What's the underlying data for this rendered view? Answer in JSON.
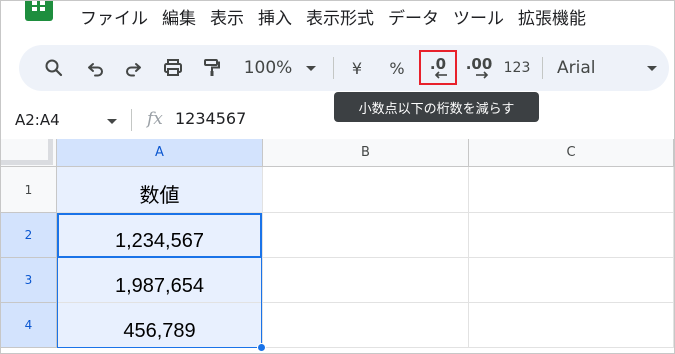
{
  "menu": [
    "ファイル",
    "編集",
    "表示",
    "挿入",
    "表示形式",
    "データ",
    "ツール",
    "拡張機能"
  ],
  "toolbar": {
    "zoom": "100%",
    "currency_label": "¥",
    "percent_label": "%",
    "decrease_decimal_label": ".0",
    "increase_decimal_label": ".00",
    "more_formats_label": "123",
    "font_name": "Arial"
  },
  "tooltip": "小数点以下の桁数を減らす",
  "formula_bar": {
    "name_box": "A2:A4",
    "fx": "fx",
    "content": "1234567"
  },
  "sheet": {
    "columns": [
      "A",
      "B",
      "C"
    ],
    "rows": [
      {
        "num": "1",
        "a": "数値"
      },
      {
        "num": "2",
        "a": "1,234,567"
      },
      {
        "num": "3",
        "a": "1,987,654"
      },
      {
        "num": "4",
        "a": "456,789"
      }
    ]
  },
  "colors": {
    "accent": "#1a73e8",
    "highlight_box": "#e8212b",
    "toolbar_bg": "#eef2f9",
    "selection_fill": "#e8f0fe"
  }
}
